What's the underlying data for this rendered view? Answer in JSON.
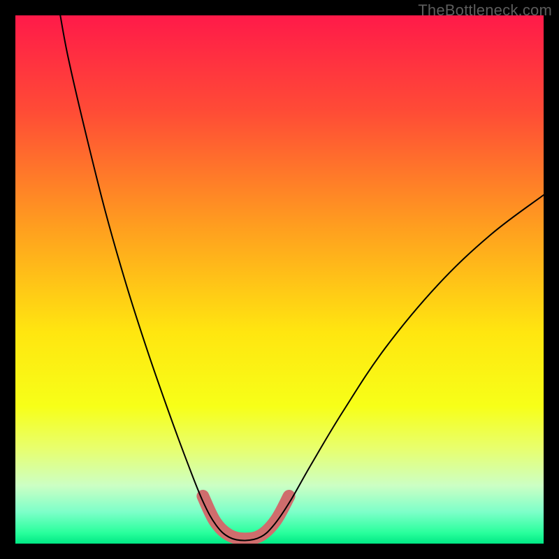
{
  "watermark": "TheBottleneck.com",
  "chart_data": {
    "type": "line",
    "title": "",
    "xlabel": "",
    "ylabel": "",
    "xlim": [
      0,
      100
    ],
    "ylim": [
      0,
      100
    ],
    "grid": false,
    "legend": false,
    "background_gradient": {
      "stops": [
        {
          "offset": 0.0,
          "color": "#ff1a49"
        },
        {
          "offset": 0.18,
          "color": "#ff4b36"
        },
        {
          "offset": 0.4,
          "color": "#ff9e1f"
        },
        {
          "offset": 0.6,
          "color": "#ffe610"
        },
        {
          "offset": 0.74,
          "color": "#f7ff18"
        },
        {
          "offset": 0.82,
          "color": "#e8ff6e"
        },
        {
          "offset": 0.89,
          "color": "#ccffc4"
        },
        {
          "offset": 0.94,
          "color": "#7dffc9"
        },
        {
          "offset": 0.98,
          "color": "#28ff9c"
        },
        {
          "offset": 1.0,
          "color": "#00e884"
        }
      ]
    },
    "series": [
      {
        "name": "bottleneck-curve",
        "stroke": "#000000",
        "stroke_width": 2.0,
        "points": [
          {
            "x": 8.5,
            "y": 100.0
          },
          {
            "x": 10.0,
            "y": 92.0
          },
          {
            "x": 13.0,
            "y": 79.0
          },
          {
            "x": 17.0,
            "y": 63.0
          },
          {
            "x": 21.0,
            "y": 49.0
          },
          {
            "x": 25.0,
            "y": 36.5
          },
          {
            "x": 29.0,
            "y": 25.0
          },
          {
            "x": 32.5,
            "y": 15.5
          },
          {
            "x": 35.5,
            "y": 8.0
          },
          {
            "x": 38.0,
            "y": 3.5
          },
          {
            "x": 40.5,
            "y": 1.2
          },
          {
            "x": 43.5,
            "y": 0.6
          },
          {
            "x": 46.5,
            "y": 1.3
          },
          {
            "x": 49.0,
            "y": 3.6
          },
          {
            "x": 52.0,
            "y": 8.0
          },
          {
            "x": 56.0,
            "y": 15.0
          },
          {
            "x": 62.0,
            "y": 25.0
          },
          {
            "x": 70.0,
            "y": 37.0
          },
          {
            "x": 80.0,
            "y": 49.0
          },
          {
            "x": 90.0,
            "y": 58.5
          },
          {
            "x": 100.0,
            "y": 66.0
          }
        ]
      },
      {
        "name": "highlight-band",
        "stroke": "#cf6d6d",
        "stroke_width": 18,
        "points": [
          {
            "x": 35.5,
            "y": 9.0
          },
          {
            "x": 37.8,
            "y": 4.2
          },
          {
            "x": 40.5,
            "y": 1.6
          },
          {
            "x": 43.5,
            "y": 0.9
          },
          {
            "x": 46.5,
            "y": 1.6
          },
          {
            "x": 49.3,
            "y": 4.4
          },
          {
            "x": 51.8,
            "y": 9.0
          }
        ]
      }
    ]
  }
}
